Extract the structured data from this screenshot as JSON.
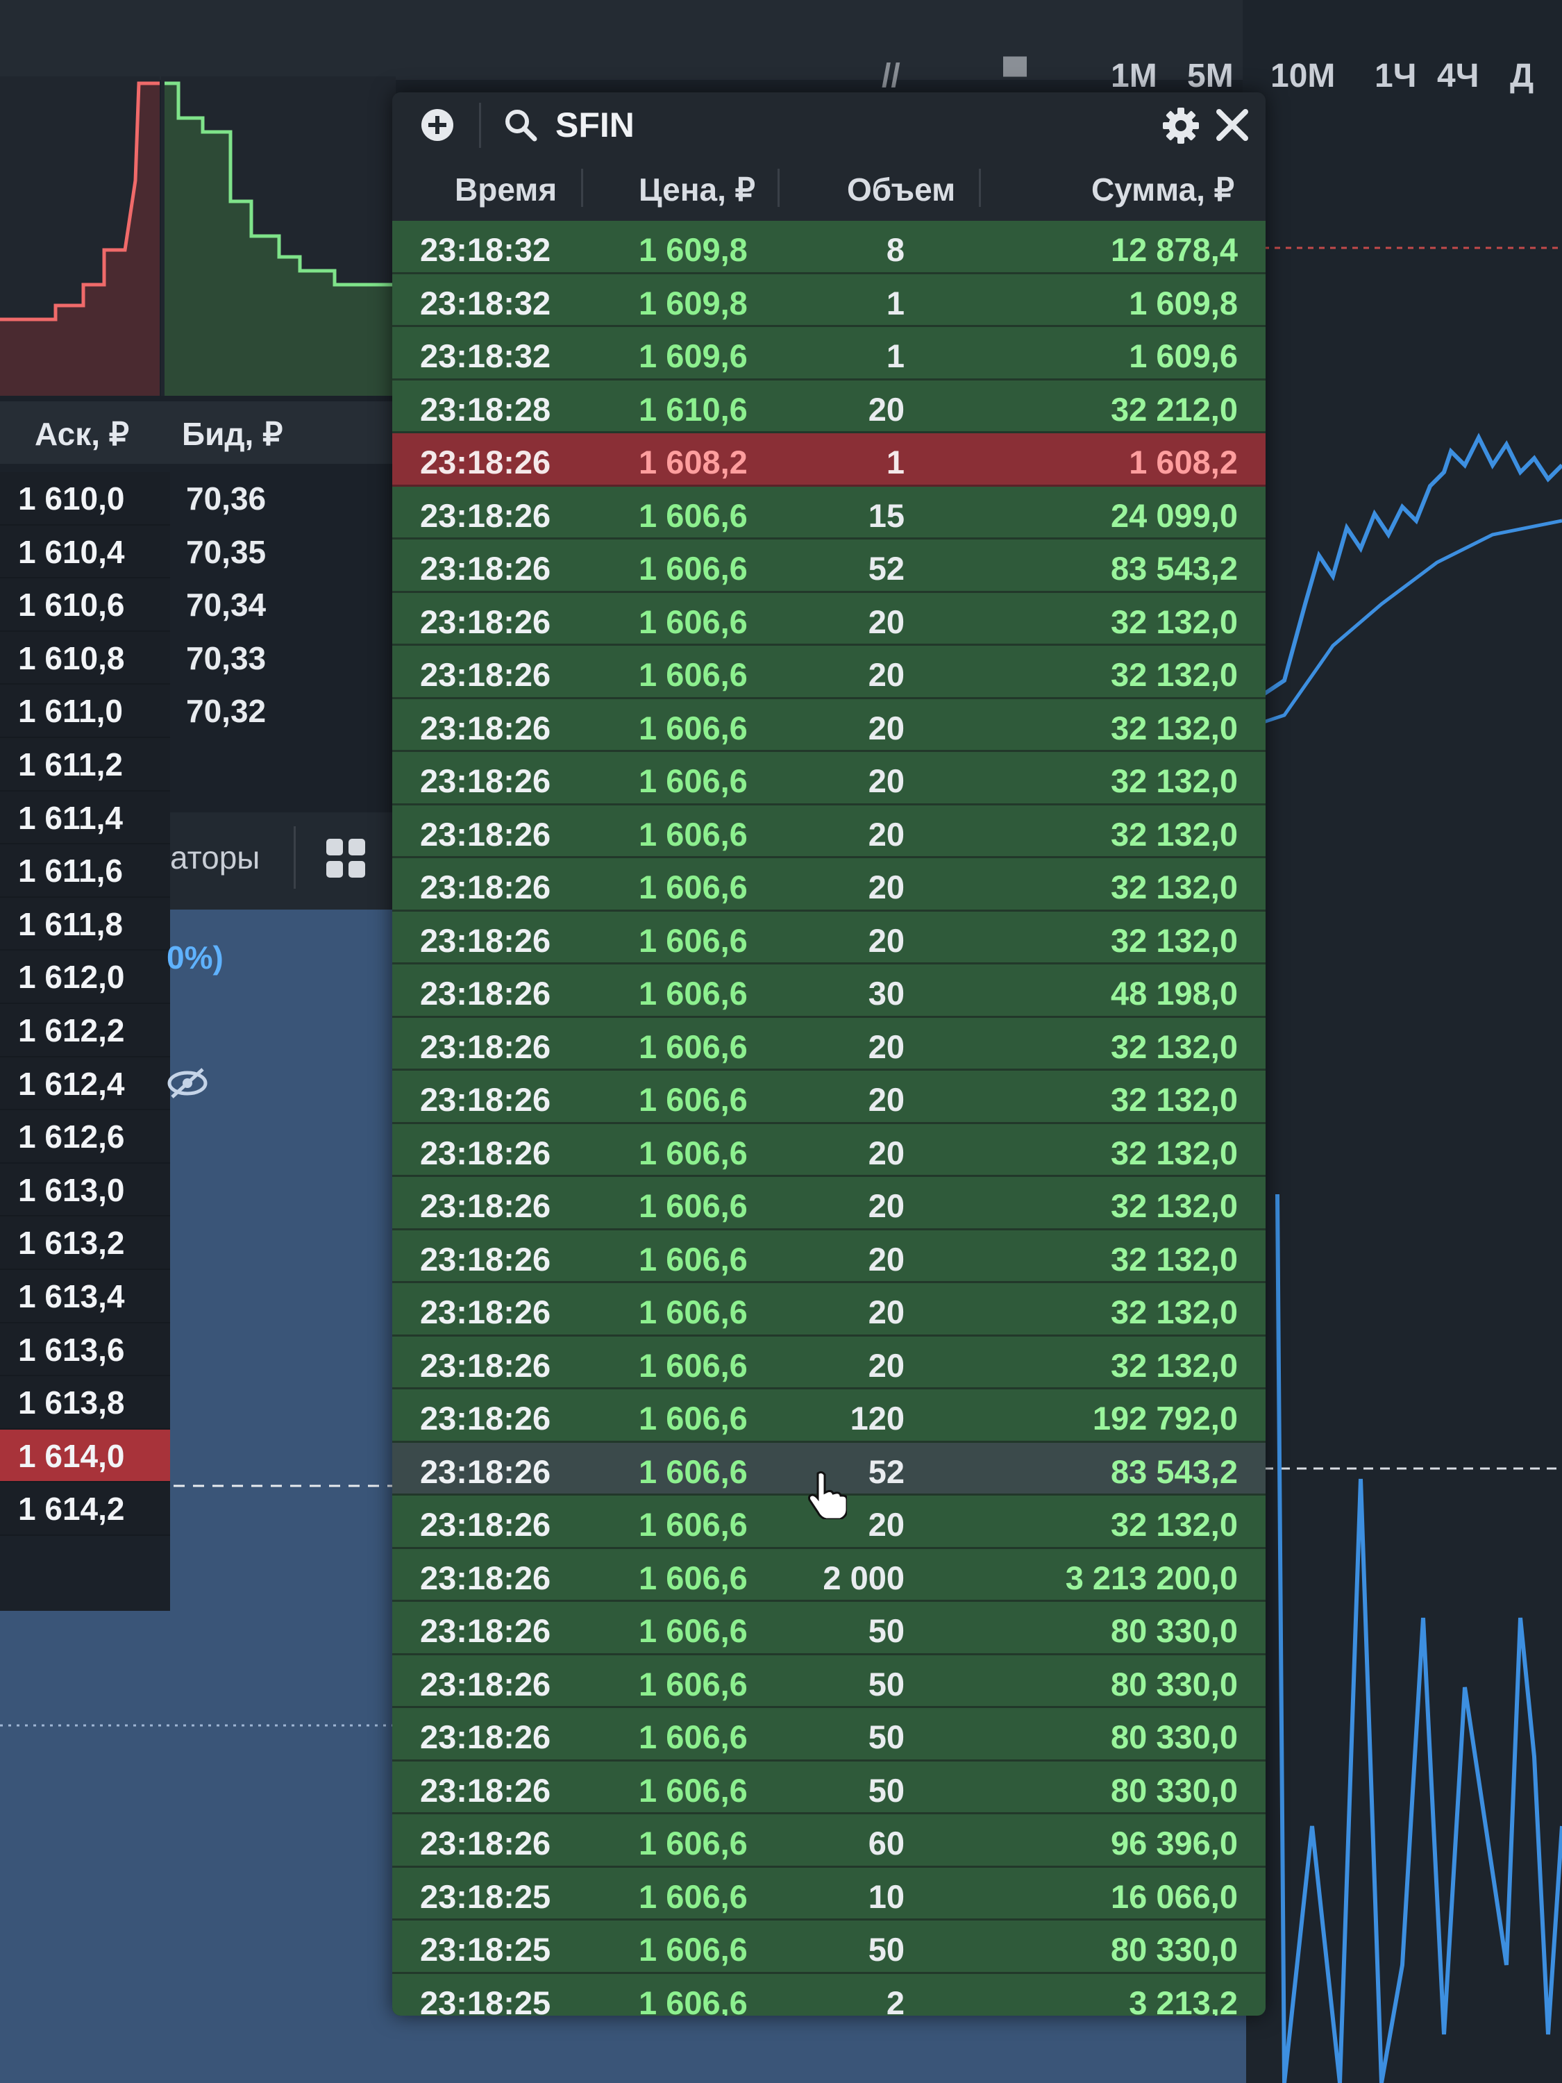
{
  "timeframes": [
    "1М",
    "5М",
    "10М",
    "1Ч",
    "4Ч",
    "Д"
  ],
  "order_book": {
    "ask_header": "Аск, ₽",
    "bid_header": "Бид, ₽",
    "asks": [
      "1 610,0",
      "1 610,4",
      "1 610,6",
      "1 610,8",
      "1 611,0",
      "1 611,2",
      "1 611,4",
      "1 611,6",
      "1 611,8",
      "1 612,0",
      "1 612,2",
      "1 612,4",
      "1 612,6",
      "1 613,0",
      "1 613,2",
      "1 613,4",
      "1 613,6",
      "1 613,8",
      "1 614,0",
      "1 614,2"
    ],
    "highlighted_ask": "1 614,0",
    "bids": [
      "70,36",
      "70,35",
      "70,34",
      "70,33",
      "70,32"
    ]
  },
  "side_panel": {
    "tab_fragment": "аторы",
    "percent_fragment": "0%)"
  },
  "trades_widget": {
    "ticker": "SFIN",
    "columns": {
      "time": "Время",
      "price": "Цена, ₽",
      "volume": "Объем",
      "sum": "Сумма, ₽"
    },
    "rows": [
      {
        "time": "23:18:32",
        "price": "1 609,8",
        "volume": "8",
        "sum": "12 878,4",
        "side": "buy"
      },
      {
        "time": "23:18:32",
        "price": "1 609,8",
        "volume": "1",
        "sum": "1 609,8",
        "side": "buy"
      },
      {
        "time": "23:18:32",
        "price": "1 609,6",
        "volume": "1",
        "sum": "1 609,6",
        "side": "buy"
      },
      {
        "time": "23:18:28",
        "price": "1 610,6",
        "volume": "20",
        "sum": "32 212,0",
        "side": "buy"
      },
      {
        "time": "23:18:26",
        "price": "1 608,2",
        "volume": "1",
        "sum": "1 608,2",
        "side": "sell"
      },
      {
        "time": "23:18:26",
        "price": "1 606,6",
        "volume": "15",
        "sum": "24 099,0",
        "side": "buy"
      },
      {
        "time": "23:18:26",
        "price": "1 606,6",
        "volume": "52",
        "sum": "83 543,2",
        "side": "buy"
      },
      {
        "time": "23:18:26",
        "price": "1 606,6",
        "volume": "20",
        "sum": "32 132,0",
        "side": "buy"
      },
      {
        "time": "23:18:26",
        "price": "1 606,6",
        "volume": "20",
        "sum": "32 132,0",
        "side": "buy"
      },
      {
        "time": "23:18:26",
        "price": "1 606,6",
        "volume": "20",
        "sum": "32 132,0",
        "side": "buy"
      },
      {
        "time": "23:18:26",
        "price": "1 606,6",
        "volume": "20",
        "sum": "32 132,0",
        "side": "buy"
      },
      {
        "time": "23:18:26",
        "price": "1 606,6",
        "volume": "20",
        "sum": "32 132,0",
        "side": "buy"
      },
      {
        "time": "23:18:26",
        "price": "1 606,6",
        "volume": "20",
        "sum": "32 132,0",
        "side": "buy"
      },
      {
        "time": "23:18:26",
        "price": "1 606,6",
        "volume": "20",
        "sum": "32 132,0",
        "side": "buy"
      },
      {
        "time": "23:18:26",
        "price": "1 606,6",
        "volume": "30",
        "sum": "48 198,0",
        "side": "buy"
      },
      {
        "time": "23:18:26",
        "price": "1 606,6",
        "volume": "20",
        "sum": "32 132,0",
        "side": "buy"
      },
      {
        "time": "23:18:26",
        "price": "1 606,6",
        "volume": "20",
        "sum": "32 132,0",
        "side": "buy"
      },
      {
        "time": "23:18:26",
        "price": "1 606,6",
        "volume": "20",
        "sum": "32 132,0",
        "side": "buy"
      },
      {
        "time": "23:18:26",
        "price": "1 606,6",
        "volume": "20",
        "sum": "32 132,0",
        "side": "buy"
      },
      {
        "time": "23:18:26",
        "price": "1 606,6",
        "volume": "20",
        "sum": "32 132,0",
        "side": "buy"
      },
      {
        "time": "23:18:26",
        "price": "1 606,6",
        "volume": "20",
        "sum": "32 132,0",
        "side": "buy"
      },
      {
        "time": "23:18:26",
        "price": "1 606,6",
        "volume": "20",
        "sum": "32 132,0",
        "side": "buy"
      },
      {
        "time": "23:18:26",
        "price": "1 606,6",
        "volume": "120",
        "sum": "192 792,0",
        "side": "buy"
      },
      {
        "time": "23:18:26",
        "price": "1 606,6",
        "volume": "52",
        "sum": "83 543,2",
        "side": "hover"
      },
      {
        "time": "23:18:26",
        "price": "1 606,6",
        "volume": "20",
        "sum": "32 132,0",
        "side": "buy"
      },
      {
        "time": "23:18:26",
        "price": "1 606,6",
        "volume": "2 000",
        "sum": "3 213 200,0",
        "side": "buy"
      },
      {
        "time": "23:18:26",
        "price": "1 606,6",
        "volume": "50",
        "sum": "80 330,0",
        "side": "buy"
      },
      {
        "time": "23:18:26",
        "price": "1 606,6",
        "volume": "50",
        "sum": "80 330,0",
        "side": "buy"
      },
      {
        "time": "23:18:26",
        "price": "1 606,6",
        "volume": "50",
        "sum": "80 330,0",
        "side": "buy"
      },
      {
        "time": "23:18:26",
        "price": "1 606,6",
        "volume": "50",
        "sum": "80 330,0",
        "side": "buy"
      },
      {
        "time": "23:18:26",
        "price": "1 606,6",
        "volume": "60",
        "sum": "96 396,0",
        "side": "buy"
      },
      {
        "time": "23:18:25",
        "price": "1 606,6",
        "volume": "10",
        "sum": "16 066,0",
        "side": "buy"
      },
      {
        "time": "23:18:25",
        "price": "1 606,6",
        "volume": "50",
        "sum": "80 330,0",
        "side": "buy"
      },
      {
        "time": "23:18:25",
        "price": "1 606,6",
        "volume": "2",
        "sum": "3 213,2",
        "side": "buy"
      }
    ]
  },
  "colors": {
    "buy_row": "#2f5a3a",
    "sell_row": "#8a2f36",
    "buy_text": "#8df08f",
    "sell_text": "#ff9e9e",
    "chart_line": "#3d8fe0"
  },
  "icons": [
    "add-icon",
    "search-icon",
    "gear-icon",
    "close-icon",
    "grid-icon",
    "eye-off-icon",
    "hand-cursor-icon"
  ]
}
